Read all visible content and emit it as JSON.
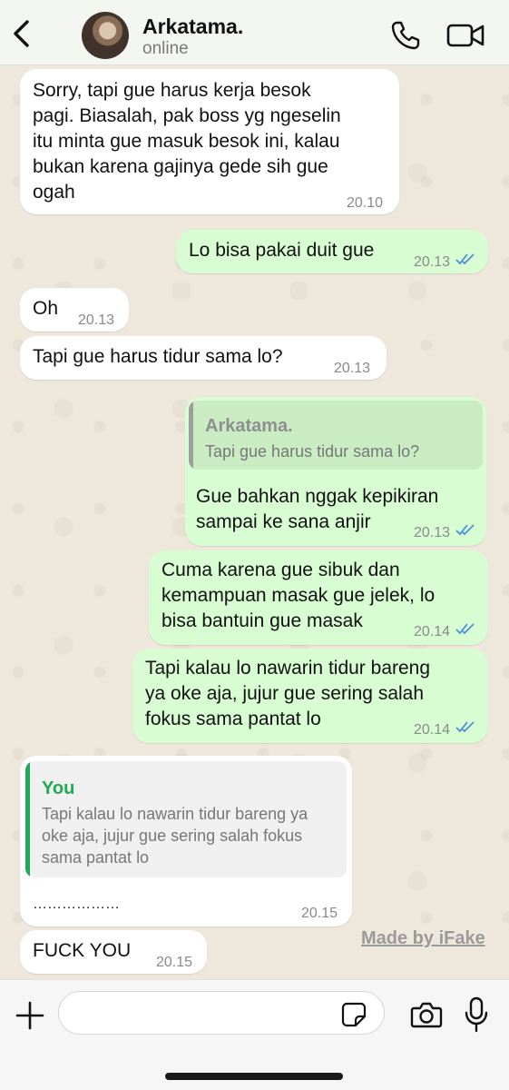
{
  "header": {
    "contact_name": "Arkatama.",
    "status": "online"
  },
  "messages": [
    {
      "dir": "in",
      "text": "Sorry, tapi gue harus kerja besok\npagi. Biasalah, pak boss yg ngeselin\nitu minta gue masuk besok ini, kalau\nbukan karena gajinya gede sih gue\nogah",
      "time": "20.10"
    },
    {
      "dir": "out",
      "text": "Lo bisa pakai duit gue",
      "time": "20.13"
    },
    {
      "dir": "in",
      "text": "Oh",
      "time": "20.13"
    },
    {
      "dir": "in",
      "text": "Tapi gue harus tidur sama lo?",
      "time": "20.13"
    },
    {
      "dir": "out",
      "quote_author": "Arkatama.",
      "quote_text": "Tapi gue harus tidur sama lo?",
      "text": "Gue bahkan nggak kepikiran\nsampai ke sana anjir",
      "time": "20.13"
    },
    {
      "dir": "out",
      "text": "Cuma karena gue sibuk dan\nkemampuan masak gue jelek, lo\nbisa bantuin gue masak",
      "time": "20.14"
    },
    {
      "dir": "out",
      "text": "Tapi kalau lo nawarin tidur bareng\nya oke aja, jujur gue sering salah\nfokus sama pantat lo",
      "time": "20.14"
    },
    {
      "dir": "in",
      "quote_author": "You",
      "quote_text": "Tapi kalau lo nawarin tidur bareng ya\noke aja, jujur gue sering salah fokus\nsama pantat lo",
      "text": "………………",
      "time": "20.15"
    },
    {
      "dir": "in",
      "text": "FUCK YOU",
      "time": "20.15"
    }
  ],
  "watermark": "Made by iFake",
  "input": {
    "placeholder": ""
  },
  "icons": {
    "back": "chevron-left-icon",
    "call": "phone-icon",
    "video": "video-camera-icon",
    "add": "plus-icon",
    "sticker": "sticker-icon",
    "camera": "camera-icon",
    "mic": "microphone-icon",
    "read_receipt": "double-check-icon"
  },
  "colors": {
    "incoming_bubble": "#ffffff",
    "outgoing_bubble": "#d9fdd3",
    "read_ticks": "#4a90d9",
    "quote_you": "#1fa855",
    "quote_contact": "#9e9e9e"
  }
}
